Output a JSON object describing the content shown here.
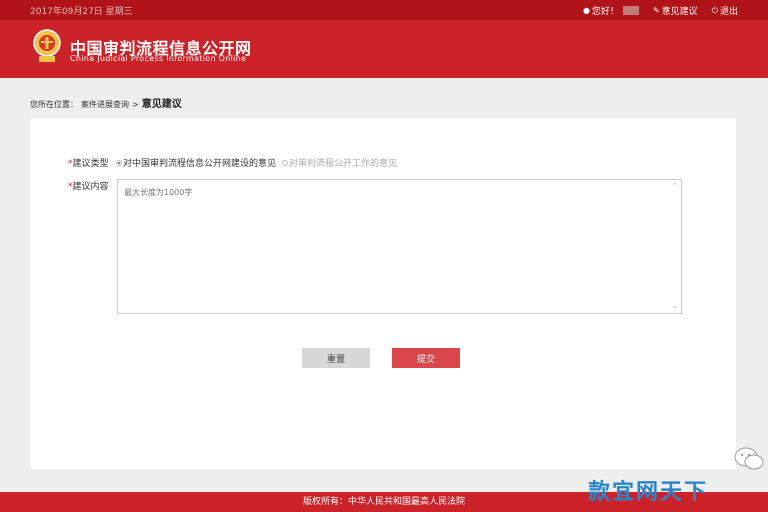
{
  "topbar": {
    "date": "2017年09月27日 星期三",
    "greeting": "您好！",
    "feedback_link": "意见建议",
    "logout": "退出",
    "icons": {
      "user": "user-icon",
      "feedback": "edit-icon",
      "logout": "power-icon"
    }
  },
  "header": {
    "title_cn": "中国审判流程信息公开网",
    "title_en": "China Judicial Process Information Online"
  },
  "breadcrumb": {
    "prefix": "您所在位置：",
    "parent": "案件进展查询",
    "separator": ">",
    "current": "意见建议"
  },
  "form": {
    "type_label": "建议类型",
    "content_label": "建议内容",
    "required_mark": "*",
    "options": [
      {
        "label": "对中国审判流程信息公开网建设的意见",
        "selected": true
      },
      {
        "label": "对审判流程公开工作的意见",
        "selected": false
      }
    ],
    "content_placeholder": "最大长度为1000字",
    "reset_label": "重置",
    "submit_label": "提交"
  },
  "footer": {
    "copyright": "版权所有：中华人民共和国最高人民法院"
  },
  "watermark": {
    "text": "款宜网天下"
  },
  "colors": {
    "brand_red": "#cc2229",
    "topbar_red": "#b01318",
    "submit_red": "#d9474c",
    "watermark_blue": "#2a84c9"
  }
}
